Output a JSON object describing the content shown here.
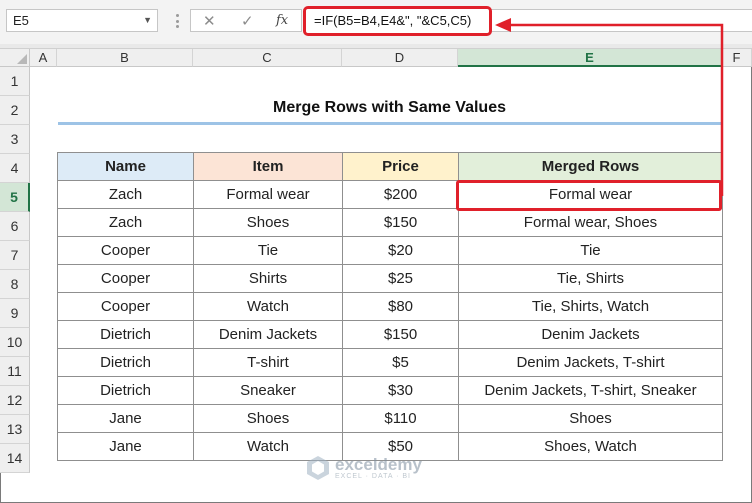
{
  "formula_bar": {
    "name_box": "E5",
    "cancel_glyph": "✕",
    "enter_glyph": "✓",
    "fx_label": "fx",
    "formula": "=IF(B5=B4,E4&\", \"&C5,C5)"
  },
  "sheet": {
    "columns": [
      "A",
      "B",
      "C",
      "D",
      "E",
      "F"
    ],
    "selected_column": "E",
    "rows": [
      "1",
      "2",
      "3",
      "4",
      "5",
      "6",
      "7",
      "8",
      "9",
      "10",
      "11",
      "12",
      "13",
      "14"
    ],
    "selected_row": "5",
    "title": "Merge Rows with Same Values"
  },
  "table": {
    "headers": {
      "name": "Name",
      "item": "Item",
      "price": "Price",
      "merged": "Merged Rows"
    },
    "rows": [
      {
        "name": "Zach",
        "item": "Formal wear",
        "price": "$200",
        "merged": "Formal wear"
      },
      {
        "name": "Zach",
        "item": "Shoes",
        "price": "$150",
        "merged": "Formal wear, Shoes"
      },
      {
        "name": "Cooper",
        "item": "Tie",
        "price": "$20",
        "merged": "Tie"
      },
      {
        "name": "Cooper",
        "item": "Shirts",
        "price": "$25",
        "merged": "Tie, Shirts"
      },
      {
        "name": "Cooper",
        "item": "Watch",
        "price": "$80",
        "merged": "Tie, Shirts, Watch"
      },
      {
        "name": "Dietrich",
        "item": "Denim Jackets",
        "price": "$150",
        "merged": "Denim Jackets"
      },
      {
        "name": "Dietrich",
        "item": "T-shirt",
        "price": "$5",
        "merged": "Denim Jackets, T-shirt"
      },
      {
        "name": "Dietrich",
        "item": "Sneaker",
        "price": "$30",
        "merged": "Denim Jackets, T-shirt, Sneaker"
      },
      {
        "name": "Jane",
        "item": "Shoes",
        "price": "$110",
        "merged": "Shoes"
      },
      {
        "name": "Jane",
        "item": "Watch",
        "price": "$50",
        "merged": "Shoes, Watch"
      }
    ]
  },
  "watermark": {
    "brand": "exceldemy",
    "tagline": "EXCEL · DATA · BI"
  },
  "colors": {
    "highlight_red": "#e0202a",
    "excel_green": "#217346",
    "name_header": "#ddebf7",
    "item_header": "#fce4d6",
    "price_header": "#fff2cc",
    "merged_header": "#e2efda"
  }
}
